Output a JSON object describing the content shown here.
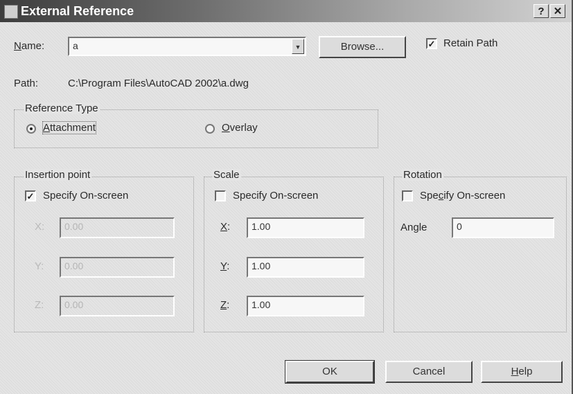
{
  "window": {
    "title": "External Reference",
    "help_glyph": "?",
    "close_glyph": "✕"
  },
  "name_row": {
    "label": "Name:",
    "value": "a",
    "browse_label": "Browse...",
    "retain_path_label": "Retain Path",
    "retain_path_checked": true
  },
  "path_row": {
    "label": "Path:",
    "value": "C:\\Program Files\\AutoCAD 2002\\a.dwg"
  },
  "reference_type": {
    "title": "Reference Type",
    "attachment_label": "Attachment",
    "overlay_label": "Overlay",
    "selected": "attachment"
  },
  "insertion_point": {
    "title": "Insertion point",
    "specify_label": "Specify On-screen",
    "specify_checked": true,
    "x_label": "X:",
    "y_label": "Y:",
    "z_label": "Z:",
    "x_value": "0.00",
    "y_value": "0.00",
    "z_value": "0.00"
  },
  "scale": {
    "title": "Scale",
    "specify_label": "Specify On-screen",
    "specify_checked": false,
    "x_label": "X:",
    "y_label": "Y:",
    "z_label": "Z:",
    "x_value": "1.00",
    "y_value": "1.00",
    "z_value": "1.00"
  },
  "rotation": {
    "title": "Rotation",
    "specify_label": "Specify On-screen",
    "specify_checked": false,
    "angle_label": "Angle",
    "angle_value": "0"
  },
  "buttons": {
    "ok": "OK",
    "cancel": "Cancel",
    "help": "Help"
  }
}
